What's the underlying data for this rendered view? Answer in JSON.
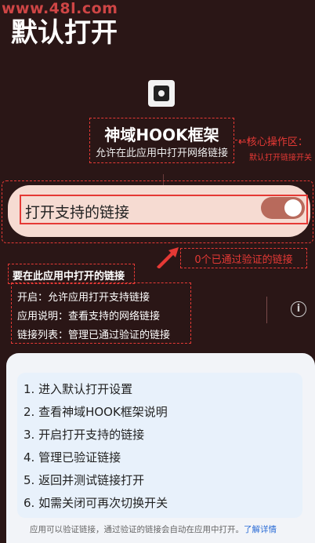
{
  "watermark": "www.48l.com",
  "page": {
    "title": "默认打开"
  },
  "app": {
    "name": "神域HOOK框架",
    "description": "允许在此应用中打开网络链接"
  },
  "callouts": {
    "core": "←核心操作区：",
    "core_sub": "默认打开链接开关",
    "verified_links": "0个已通过验证的链接",
    "open_in_app": "要在此应用中打开的链接"
  },
  "toggle": {
    "label": "打开支持的链接",
    "state": "on"
  },
  "info": {
    "lines": [
      "开启：允许应用打开支持链接",
      "应用说明：查看支持的网络链接",
      "链接列表：管理已通过验证的链接"
    ],
    "icon": "info-icon"
  },
  "steps": [
    "1. 进入默认打开设置",
    "2. 查看神域HOOK框架说明",
    "3. 开启打开支持的链接",
    "4. 管理已验证链接",
    "5. 返回并测试链接打开",
    "6. 如需关闭可再次切换开关"
  ],
  "footer": {
    "text": "应用可以验证链接，通过验证的链接会自动在应用中打开。",
    "link": "了解详情"
  },
  "colors": {
    "accent_red": "#e53935",
    "background": "#2a1616",
    "toggle_card": "#f6dbd2",
    "switch_on": "#b86a5c"
  }
}
